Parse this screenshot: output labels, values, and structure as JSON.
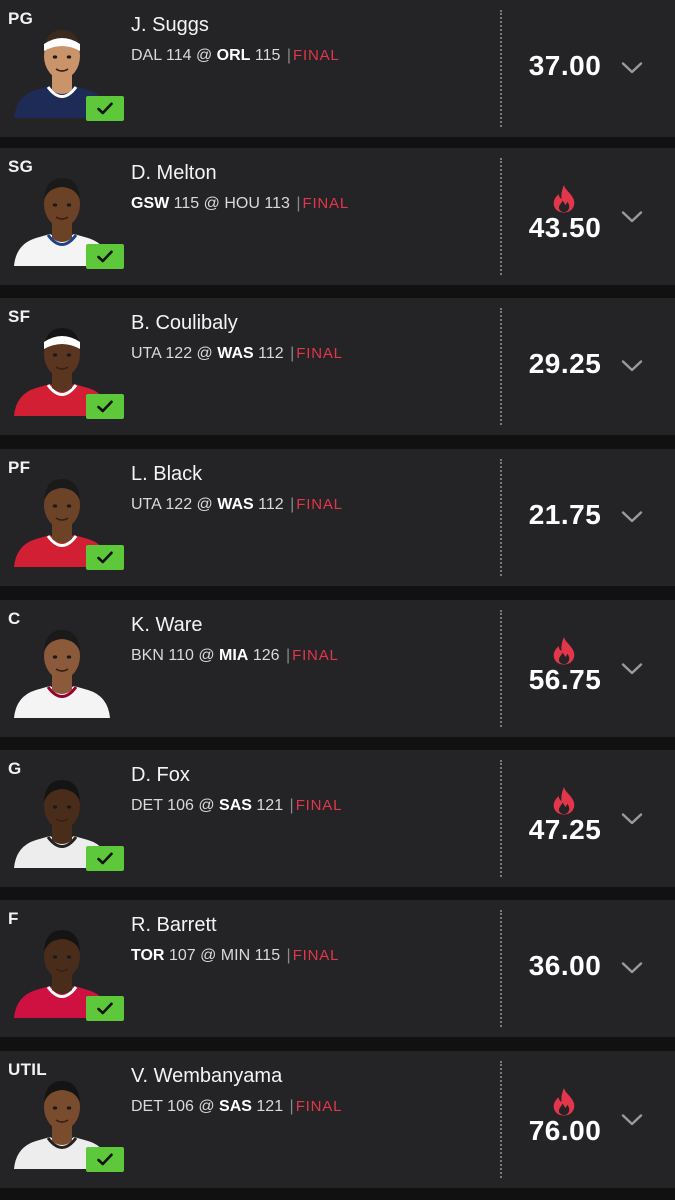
{
  "lineup": [
    {
      "position": "PG",
      "player": "J. Suggs",
      "away_team": "DAL",
      "away_score": "114",
      "at": "@",
      "home_team": "ORL",
      "home_score": "115",
      "separator": "|",
      "status": "FINAL",
      "bold_team": "home",
      "fantasy_points": "37.00",
      "hot": false,
      "checked": true,
      "jersey_color": "#1f2b57",
      "jersey_trim": "#ffffff",
      "skin": "#c9946a",
      "hair": "#3a2a1d",
      "headband": "#ffffff"
    },
    {
      "position": "SG",
      "player": "D. Melton",
      "away_team": "GSW",
      "away_score": "115",
      "at": "@",
      "home_team": "HOU",
      "home_score": "113",
      "separator": "|",
      "status": "FINAL",
      "bold_team": "away",
      "fantasy_points": "43.50",
      "hot": true,
      "checked": true,
      "jersey_color": "#f4f4f4",
      "jersey_trim": "#1d428a",
      "skin": "#6b4226",
      "hair": "#1a1a1a",
      "headband": ""
    },
    {
      "position": "SF",
      "player": "B. Coulibaly",
      "away_team": "UTA",
      "away_score": "122",
      "at": "@",
      "home_team": "WAS",
      "home_score": "112",
      "separator": "|",
      "status": "FINAL",
      "bold_team": "home",
      "fantasy_points": "29.25",
      "hot": false,
      "checked": true,
      "jersey_color": "#d21f34",
      "jersey_trim": "#ffffff",
      "skin": "#5a3620",
      "hair": "#141414",
      "headband": "#ffffff"
    },
    {
      "position": "PF",
      "player": "L. Black",
      "away_team": "UTA",
      "away_score": "122",
      "at": "@",
      "home_team": "WAS",
      "home_score": "112",
      "separator": "|",
      "status": "FINAL",
      "bold_team": "home",
      "fantasy_points": "21.75",
      "hot": false,
      "checked": true,
      "jersey_color": "#d21f34",
      "jersey_trim": "#ffffff",
      "skin": "#6d4328",
      "hair": "#1a1a1a",
      "headband": ""
    },
    {
      "position": "C",
      "player": "K. Ware",
      "away_team": "BKN",
      "away_score": "110",
      "at": "@",
      "home_team": "MIA",
      "home_score": "126",
      "separator": "|",
      "status": "FINAL",
      "bold_team": "home",
      "fantasy_points": "56.75",
      "hot": true,
      "checked": false,
      "jersey_color": "#f4f4f4",
      "jersey_trim": "#98002e",
      "skin": "#8a5a3a",
      "hair": "#1a1a1a",
      "headband": ""
    },
    {
      "position": "G",
      "player": "D. Fox",
      "away_team": "DET",
      "away_score": "106",
      "at": "@",
      "home_team": "SAS",
      "home_score": "121",
      "separator": "|",
      "status": "FINAL",
      "bold_team": "home",
      "fantasy_points": "47.25",
      "hot": true,
      "checked": true,
      "jersey_color": "#ededed",
      "jersey_trim": "#222222",
      "skin": "#4a2c1b",
      "hair": "#141414",
      "headband": ""
    },
    {
      "position": "F",
      "player": "R. Barrett",
      "away_team": "TOR",
      "away_score": "107",
      "at": "@",
      "home_team": "MIN",
      "home_score": "115",
      "separator": "|",
      "status": "FINAL",
      "bold_team": "away",
      "fantasy_points": "36.00",
      "hot": false,
      "checked": true,
      "jersey_color": "#ce1141",
      "jersey_trim": "#ffffff",
      "skin": "#4a2c1b",
      "hair": "#141414",
      "headband": ""
    },
    {
      "position": "UTIL",
      "player": "V. Wembanyama",
      "away_team": "DET",
      "away_score": "106",
      "at": "@",
      "home_team": "SAS",
      "home_score": "121",
      "separator": "|",
      "status": "FINAL",
      "bold_team": "home",
      "fantasy_points": "76.00",
      "hot": true,
      "checked": true,
      "jersey_color": "#ededed",
      "jersey_trim": "#222222",
      "skin": "#7a4c2e",
      "hair": "#141414",
      "headband": ""
    }
  ],
  "icons": {
    "hot": "flame-icon",
    "expand": "chevron-down-icon",
    "locked": "checkmark-icon"
  },
  "colors": {
    "card_bg": "#242426",
    "page_bg": "#111112",
    "status_final": "#e2364a",
    "flame": "#e2364a",
    "checkmark_badge": "#5cc83a"
  }
}
